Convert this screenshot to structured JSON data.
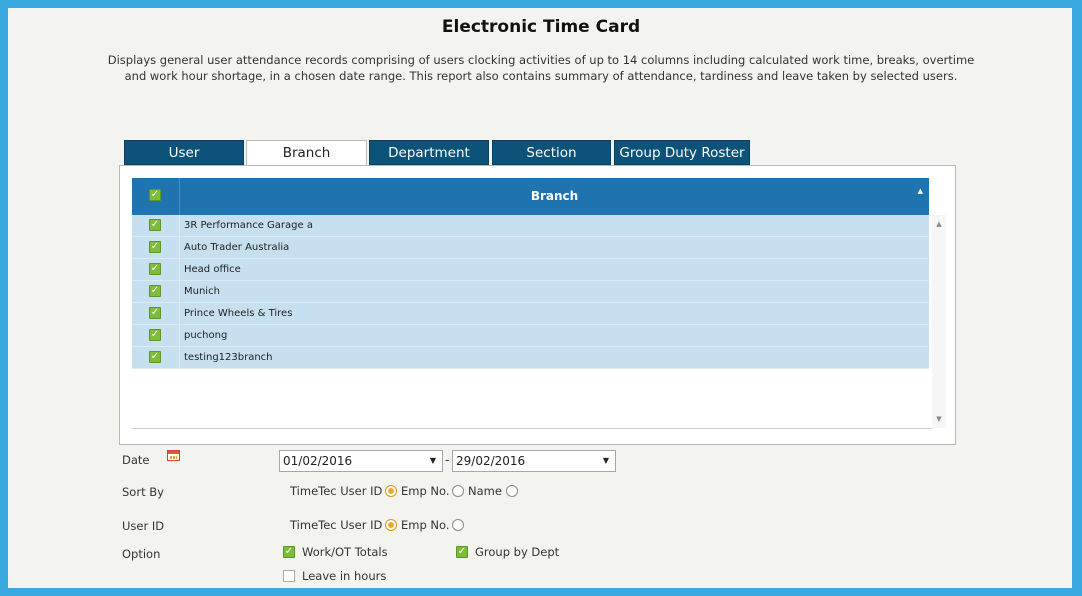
{
  "page": {
    "title": "Electronic Time Card",
    "description": "Displays general user attendance records comprising of users clocking activities of up to 14 columns including calculated work time, breaks, overtime and work hour shortage, in a chosen date range. This report also contains summary of attendance, tardiness and leave taken by selected users."
  },
  "tabs": [
    {
      "label": "User",
      "active": false
    },
    {
      "label": "Branch",
      "active": true
    },
    {
      "label": "Department",
      "active": false
    },
    {
      "label": "Section",
      "active": false
    },
    {
      "label": "Group Duty Roster",
      "active": false
    }
  ],
  "grid": {
    "header": "Branch",
    "rows": [
      {
        "label": "3R Performance Garage a",
        "checked": true
      },
      {
        "label": "Auto Trader Australia",
        "checked": true
      },
      {
        "label": "Head office",
        "checked": true
      },
      {
        "label": "Munich",
        "checked": true
      },
      {
        "label": "Prince Wheels & Tires",
        "checked": true
      },
      {
        "label": "puchong",
        "checked": true
      },
      {
        "label": "testing123branch",
        "checked": true
      }
    ]
  },
  "form": {
    "date_label": "Date",
    "date_from": "01/02/2016",
    "date_separator": "-",
    "date_to": "29/02/2016",
    "sort_by_label": "Sort By",
    "sort_options": [
      "TimeTec User ID",
      "Emp No.",
      "Name"
    ],
    "sort_selected": "TimeTec User ID",
    "user_id_label": "User ID",
    "user_id_options": [
      "TimeTec User ID",
      "Emp No."
    ],
    "user_id_selected": "TimeTec User ID",
    "option_label": "Option",
    "options": [
      {
        "label": "Work/OT Totals",
        "checked": true
      },
      {
        "label": "Group by Dept",
        "checked": true
      },
      {
        "label": "Leave in hours",
        "checked": false
      }
    ]
  },
  "colors": {
    "frame": "#3aa9e0",
    "tab_bg": "#0d5279",
    "grid_header": "#1f73ae",
    "row_bg": "#c6e0f0",
    "check_green": "#7dbd3a",
    "radio_orange": "#f0a728"
  }
}
